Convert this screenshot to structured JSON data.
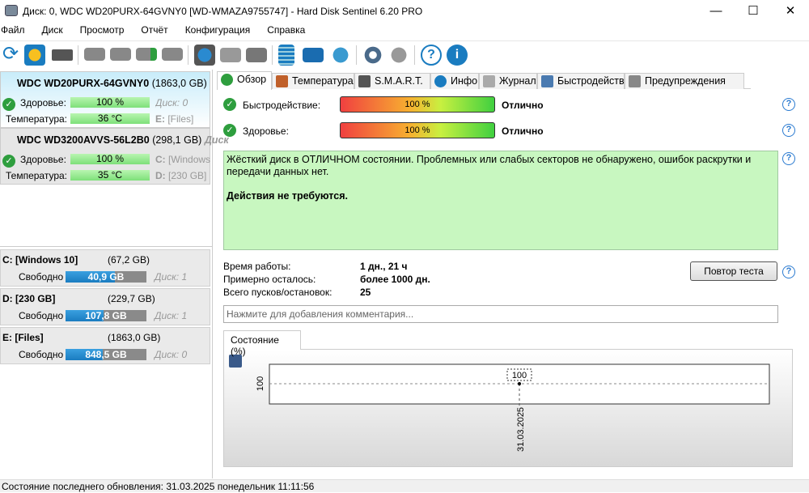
{
  "window": {
    "title": "Диск: 0, WDC WD20PURX-64GVNY0 [WD-WMAZA9755747]  -  Hard Disk Sentinel 6.20 PRO",
    "minimize": "—",
    "maximize": "☐",
    "close": "✕"
  },
  "menu": [
    "Файл",
    "Диск",
    "Просмотр",
    "Отчёт",
    "Конфигурация",
    "Справка"
  ],
  "disks": [
    {
      "name": "WDC WD20PURX-64GVNY0",
      "size": "(1863,0 GB)",
      "health_label": "Здоровье:",
      "health": "100 %",
      "temp_label": "Температура:",
      "temp": "36 °C",
      "side1": "Диск: 0",
      "side2_letter": "E:",
      "side2_name": "[Files]"
    },
    {
      "name": "WDC WD3200AVVS-56L2B0",
      "size": "(298,1 GB)",
      "extra": "Диск",
      "health_label": "Здоровье:",
      "health": "100 %",
      "temp_label": "Температура:",
      "temp": "35 °C",
      "side1_letter": "C:",
      "side1_name": "[Windows",
      "side2_letter": "D:",
      "side2_name": "[230 GB]"
    }
  ],
  "partitions": [
    {
      "name": "C: [Windows 10]",
      "size": "(67,2 GB)",
      "free_label": "Свободно",
      "free": "40,9 GB",
      "free_pct": 61,
      "disk": "Диск: 1"
    },
    {
      "name": "D: [230 GB]",
      "size": "(229,7 GB)",
      "free_label": "Свободно",
      "free": "107,8 GB",
      "free_pct": 47,
      "disk": "Диск: 1"
    },
    {
      "name": "E: [Files]",
      "size": "(1863,0 GB)",
      "free_label": "Свободно",
      "free": "848,5 GB",
      "free_pct": 46,
      "disk": "Диск: 0"
    }
  ],
  "tabs": [
    "Обзор",
    "Температура",
    "S.M.A.R.T.",
    "Инфо",
    "Журнал",
    "Быстродействие",
    "Предупреждения"
  ],
  "overview": {
    "perf_label": "Быстродействие:",
    "perf_value": "100 %",
    "perf_status": "Отлично",
    "health_label": "Здоровье:",
    "health_value": "100 %",
    "health_status": "Отлично",
    "message": "Жёсткий диск в ОТЛИЧНОМ состоянии. Проблемных или слабых секторов не обнаружено, ошибок раскрутки и передачи данных нет.",
    "action": "Действия не требуются.",
    "uptime_label": "Время работы:",
    "uptime": "1 дн., 21 ч",
    "remaining_label": "Примерно осталось:",
    "remaining": "более 1000 дн.",
    "starts_label": "Всего пусков/остановок:",
    "starts": "25",
    "retest": "Повтор теста",
    "comment_placeholder": "Нажмите для добавления комментария...",
    "help": "?"
  },
  "chart_tab": "Состояние (%)",
  "chart_data": {
    "type": "line",
    "x": [
      "31.03.2025"
    ],
    "values": [
      100
    ],
    "ylabel": "100",
    "data_label": "100"
  },
  "statusbar": "Состояние последнего обновления: 31.03.2025 понедельник 11:11:56"
}
